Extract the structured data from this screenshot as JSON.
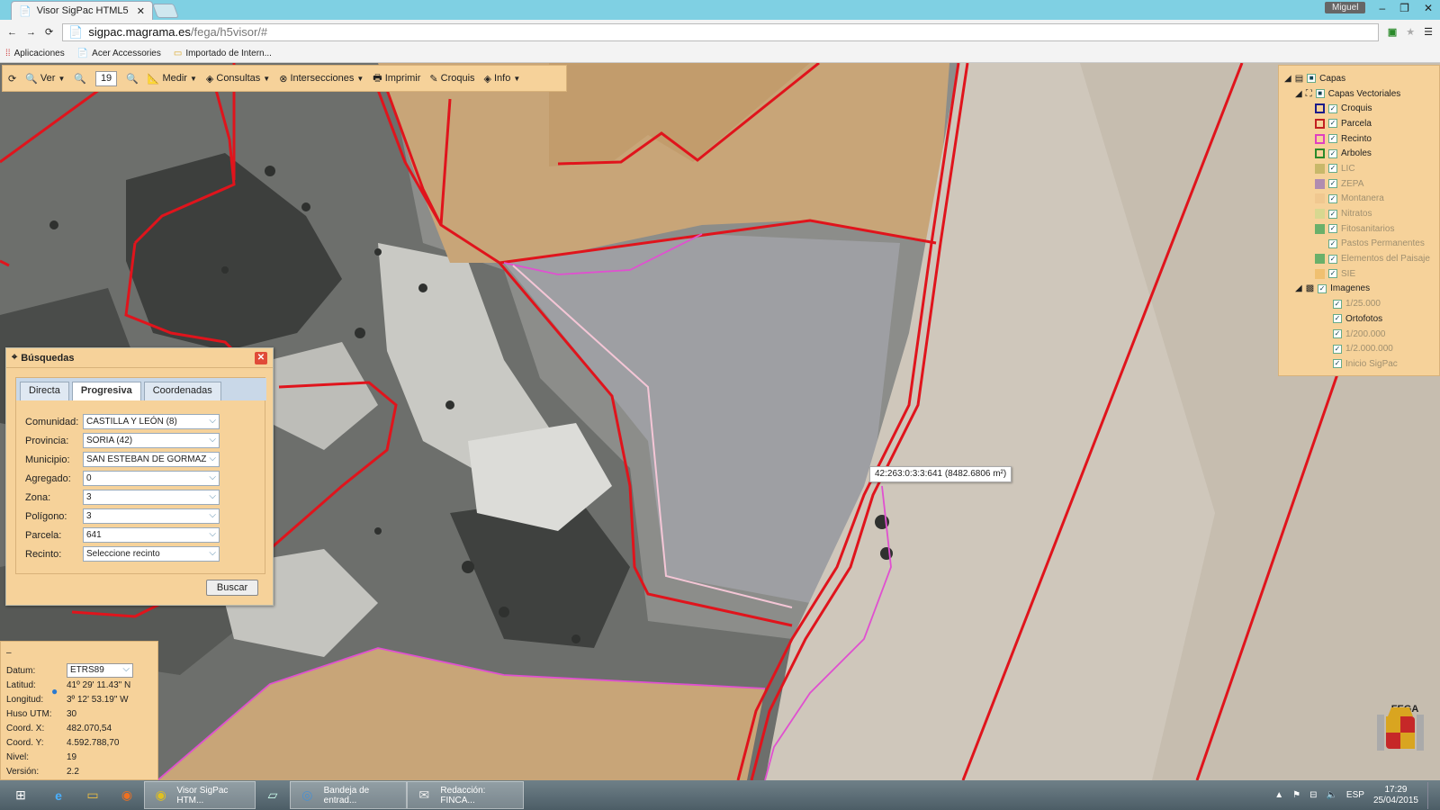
{
  "browser": {
    "tab_title": "Visor SigPac HTML5",
    "tab_close": "✕",
    "user": "Miguel",
    "url_host": "sigpac.magrama.es",
    "url_path": "/fega/h5visor/#",
    "bookmarks": [
      "Aplicaciones",
      "Acer Accessories",
      "Importado de Intern..."
    ]
  },
  "toolbar": {
    "ver": "Ver",
    "zoom_level": "19",
    "medir": "Medir",
    "consultas": "Consultas",
    "intersecciones": "Intersecciones",
    "imprimir": "Imprimir",
    "croquis": "Croquis",
    "info": "Info"
  },
  "layers": {
    "root": "Capas",
    "vector_group": "Capas Vectoriales",
    "vector": [
      {
        "name": "Croquis",
        "color": "#1b1b8a",
        "enabled": true
      },
      {
        "name": "Parcela",
        "color": "#c22020",
        "enabled": true
      },
      {
        "name": "Recinto",
        "color": "#e040c0",
        "enabled": true
      },
      {
        "name": "Arboles",
        "color": "#2a8a2a",
        "enabled": true
      },
      {
        "name": "LIC",
        "color": "#c8b86a",
        "enabled": false
      },
      {
        "name": "ZEPA",
        "color": "#b08cb0",
        "enabled": false
      },
      {
        "name": "Montanera",
        "color": "#f0c890",
        "enabled": false
      },
      {
        "name": "Nitratos",
        "color": "#d8d890",
        "enabled": false
      },
      {
        "name": "Fitosanitarios",
        "color": "#6ab06a",
        "enabled": false
      },
      {
        "name": "Pastos Permanentes",
        "color": "#f6d29a",
        "enabled": false
      },
      {
        "name": "Elementos del Paisaje",
        "color": "#6ab06a",
        "enabled": false
      },
      {
        "name": "SIE",
        "color": "#f0c070",
        "enabled": false
      }
    ],
    "image_group": "Imagenes",
    "images": [
      {
        "name": "1/25.000",
        "enabled": false
      },
      {
        "name": "Ortofotos",
        "enabled": true
      },
      {
        "name": "1/200.000",
        "enabled": false
      },
      {
        "name": "1/2.000.000",
        "enabled": false
      },
      {
        "name": "Inicio SigPac",
        "enabled": false
      }
    ]
  },
  "search": {
    "title": "Búsquedas",
    "tabs": [
      "Directa",
      "Progresiva",
      "Coordenadas"
    ],
    "fields": [
      {
        "label": "Comunidad:",
        "value": "CASTILLA Y LEÓN (8)"
      },
      {
        "label": "Provincia:",
        "value": "SORIA (42)"
      },
      {
        "label": "Municipio:",
        "value": "SAN ESTEBAN DE GORMAZ"
      },
      {
        "label": "Agregado:",
        "value": "0"
      },
      {
        "label": "Zona:",
        "value": "3"
      },
      {
        "label": "Polígono:",
        "value": "3"
      },
      {
        "label": "Parcela:",
        "value": "641"
      },
      {
        "label": "Recinto:",
        "value": "Seleccione recinto"
      }
    ],
    "button": "Buscar"
  },
  "info": {
    "collapse": "–",
    "datum_label": "Datum:",
    "datum": "ETRS89",
    "rows": [
      {
        "k": "Latitud:",
        "v": "41º 29' 11.43\" N"
      },
      {
        "k": "Longitud:",
        "v": "3º 12' 53.19\" W"
      },
      {
        "k": "Huso UTM:",
        "v": "30"
      },
      {
        "k": "Coord. X:",
        "v": "482.070,54"
      },
      {
        "k": "Coord. Y:",
        "v": "4.592.788,70"
      },
      {
        "k": "Nivel:",
        "v": "19"
      },
      {
        "k": "Versión:",
        "v": "2.2"
      }
    ]
  },
  "map": {
    "tooltip": "42:263:0:3:3:641 (8482.6806 m²)",
    "logo_label": "FEGA"
  },
  "taskbar": {
    "items": [
      {
        "label": "Visor SigPac HTM...",
        "active": true
      },
      {
        "label": "Bandeja de entrad...",
        "active": false
      },
      {
        "label": "Redacción: FINCA...",
        "active": false
      }
    ],
    "lang": "ESP",
    "time": "17:29",
    "date": "25/04/2015"
  },
  "colors": {
    "panel": "#f6d29a",
    "parcel_line": "#e0141c",
    "recinto_line": "#e050d0"
  }
}
